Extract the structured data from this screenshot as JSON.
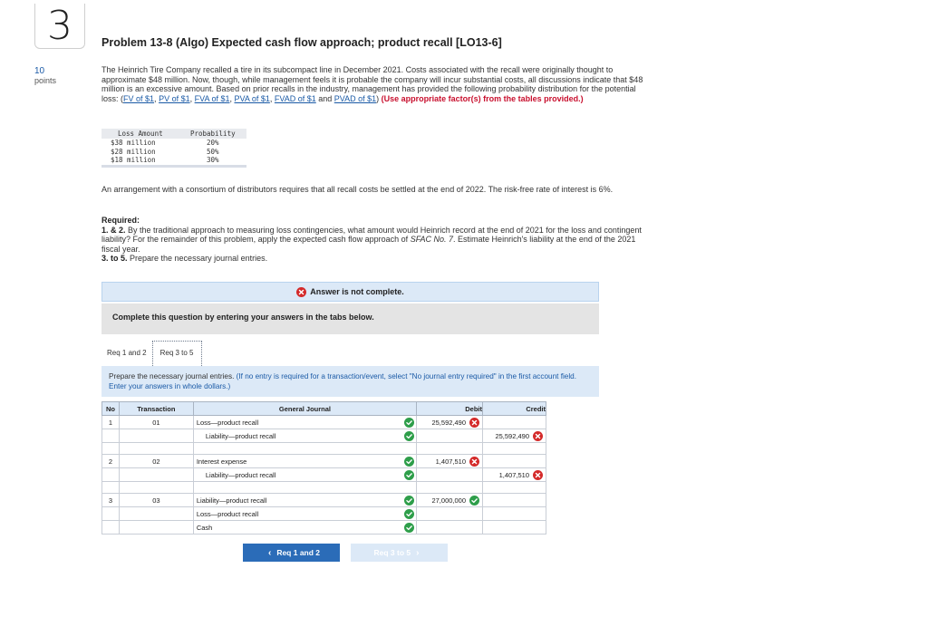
{
  "question": {
    "number": "3",
    "points_value": "10",
    "points_label": "points"
  },
  "problem": {
    "title": "Problem 13-8 (Algo) Expected cash flow approach; product recall [LO13-6]",
    "intro_text": "The Heinrich Tire Company recalled a tire in its subcompact line in December 2021. Costs associated with the recall were originally thought to approximate $48 million. Now, though, while management feels it is probable the company will incur substantial costs, all discussions indicate that $48 million is an excessive amount. Based on prior recalls in the industry, management has provided the following probability distribution for the potential loss: (",
    "links": [
      "FV of $1",
      "PV of $1",
      "FVA of $1",
      "PVA of $1",
      "FVAD of $1",
      "PVAD of $1"
    ],
    "link_sep": ", ",
    "link_and": " and ",
    "after_links": ") ",
    "red_note": "(Use appropriate factor(s) from the tables provided.)",
    "loss_table": {
      "headers": [
        "Loss Amount",
        "Probability"
      ],
      "rows": [
        [
          "$38 million",
          "20%"
        ],
        [
          "$28 million",
          "50%"
        ],
        [
          "$18 million",
          "30%"
        ]
      ]
    },
    "arrangement": "An arrangement with a consortium of distributors requires that all recall costs be settled at the end of 2022. The risk-free rate of interest is 6%.",
    "required_label": "Required:",
    "req_1_2_label": "1. & 2.",
    "req_1_2_text": " By the traditional approach to measuring loss contingencies, what amount would Heinrich record at the end of 2021 for the loss and contingent liability? For the remainder of this problem, apply the expected cash flow approach of ",
    "sfac": "SFAC No. 7",
    "req_1_2_end": ". Estimate Heinrich's liability at the end of the 2021 fiscal year.",
    "req_3_5_label": "3. to 5.",
    "req_3_5_text": " Prepare the necessary journal entries."
  },
  "answer_banner": "Answer is not complete.",
  "complete_prompt": "Complete this question by entering your answers in the tabs below.",
  "tabs": [
    {
      "label": "Req 1 and 2",
      "active": false
    },
    {
      "label": "Req 3 to 5",
      "active": true
    }
  ],
  "instruction": {
    "text": "Prepare the necessary journal entries. ",
    "blue": "(If no entry is required for a transaction/event, select \"No journal entry required\" in the first account field. Enter your answers in whole dollars.)"
  },
  "journal": {
    "headers": [
      "No",
      "Transaction",
      "General Journal",
      "Debit",
      "Credit"
    ],
    "entries": [
      {
        "no": "1",
        "transaction": "01",
        "lines": [
          {
            "account": "Loss—product recall",
            "indent": false,
            "acct_status": "correct",
            "debit": "25,592,490",
            "debit_status": "incorrect",
            "credit": "",
            "credit_status": ""
          },
          {
            "account": "Liability—product recall",
            "indent": true,
            "acct_status": "correct",
            "debit": "",
            "debit_status": "",
            "credit": "25,592,490",
            "credit_status": "incorrect"
          }
        ]
      },
      {
        "no": "2",
        "transaction": "02",
        "lines": [
          {
            "account": "Interest expense",
            "indent": false,
            "acct_status": "correct",
            "debit": "1,407,510",
            "debit_status": "incorrect",
            "credit": "",
            "credit_status": ""
          },
          {
            "account": "Liability—product recall",
            "indent": true,
            "acct_status": "correct",
            "debit": "",
            "debit_status": "",
            "credit": "1,407,510",
            "credit_status": "incorrect"
          }
        ]
      },
      {
        "no": "3",
        "transaction": "03",
        "lines": [
          {
            "account": "Liability—product recall",
            "indent": false,
            "acct_status": "correct",
            "debit": "27,000,000",
            "debit_status": "correct",
            "credit": "",
            "credit_status": ""
          },
          {
            "account": "Loss—product recall",
            "indent": false,
            "acct_status": "correct",
            "debit": "",
            "debit_status": "",
            "credit": "",
            "credit_status": ""
          },
          {
            "account": "Cash",
            "indent": false,
            "acct_status": "correct",
            "debit": "",
            "debit_status": "",
            "credit": "",
            "credit_status": ""
          }
        ]
      }
    ]
  },
  "nav": {
    "prev_label": "Req 1 and 2",
    "next_label": "Req 3 to 5"
  },
  "colors": {
    "correct": "#2e9e4a",
    "incorrect": "#d42a2a",
    "accent": "#2b6cb8",
    "banner_bg": "#dce9f7"
  },
  "icons": {
    "correct": "check-circle-icon",
    "incorrect": "x-circle-icon",
    "prev": "chevron-left-icon",
    "next": "chevron-right-icon"
  }
}
